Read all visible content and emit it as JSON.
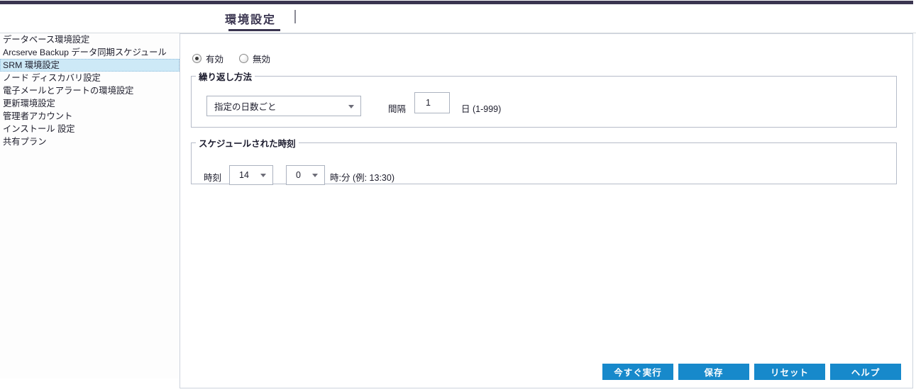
{
  "header": {
    "tab_label": "環境設定",
    "separator": "|"
  },
  "sidebar": {
    "items": [
      {
        "label": "データベース環境設定",
        "selected": false
      },
      {
        "label": "Arcserve Backup データ同期スケジュール",
        "selected": false
      },
      {
        "label": "SRM 環境設定",
        "selected": true
      },
      {
        "label": "ノード ディスカバリ設定",
        "selected": false
      },
      {
        "label": "電子メールとアラートの環境設定",
        "selected": false
      },
      {
        "label": "更新環境設定",
        "selected": false
      },
      {
        "label": "管理者アカウント",
        "selected": false
      },
      {
        "label": "インストール 設定",
        "selected": false
      },
      {
        "label": "共有プラン",
        "selected": false
      }
    ]
  },
  "main": {
    "enable_radio": {
      "enabled_label": "有効",
      "disabled_label": "無効",
      "selected": "有効"
    },
    "repeat_group": {
      "legend": "繰り返し方法",
      "method_value": "指定の日数ごと",
      "interval_label": "間隔",
      "interval_value": "1",
      "interval_unit": "日 (1-999)"
    },
    "schedule_group": {
      "legend": "スケジュールされた時刻",
      "time_label": "時刻",
      "hour_value": "14",
      "minute_value": "0",
      "format_hint": "時:分 (例: 13:30)"
    },
    "buttons": [
      {
        "label": "今すぐ実行"
      },
      {
        "label": "保存"
      },
      {
        "label": "リセット"
      },
      {
        "label": "ヘルプ"
      }
    ]
  },
  "colors": {
    "accent_blue": "#1789cb",
    "header_dark": "#3a3550",
    "sidebar_selected_bg": "#cde9f7"
  }
}
